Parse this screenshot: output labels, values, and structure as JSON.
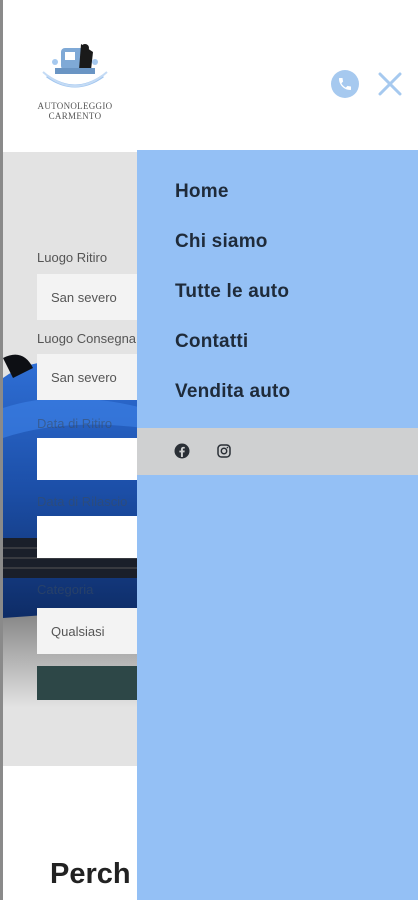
{
  "header": {
    "logo_text": "AUTONOLEGGIO CARMENTO",
    "phone_icon": "phone-icon",
    "close_icon": "close-icon"
  },
  "hero": {
    "form": {
      "pickup_label": "Luogo Ritiro",
      "pickup_value": "San severo",
      "dropoff_label": "Luogo Consegna",
      "dropoff_value": "San severo",
      "pickup_date_label": "Data di Ritiro",
      "return_date_label": "Data di Rilascio",
      "category_label": "Categoria",
      "category_value": "Qualsiasi"
    }
  },
  "section": {
    "heading": "Perch"
  },
  "menu": {
    "items": [
      {
        "label": "Home"
      },
      {
        "label": "Chi siamo"
      },
      {
        "label": "Tutte le auto"
      },
      {
        "label": "Contatti"
      },
      {
        "label": "Vendita auto"
      }
    ],
    "social": [
      "facebook-icon",
      "instagram-icon"
    ]
  },
  "colors": {
    "menu_bg": "#94c0f5",
    "social_bar_bg": "#cfd0d1",
    "accent": "#a6c9ef",
    "button_dark": "#2d4747"
  }
}
